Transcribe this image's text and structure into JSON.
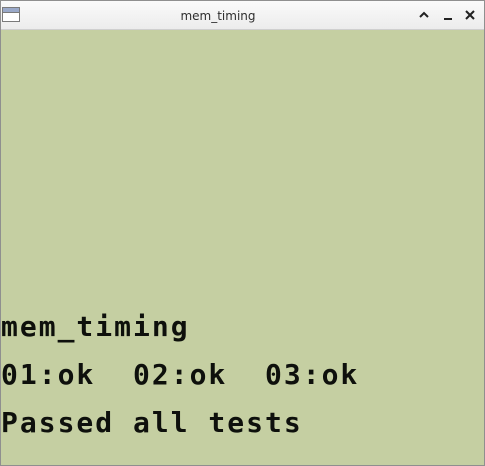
{
  "window": {
    "title": "mem_timing",
    "controls": {
      "maximize": "chevron-up-icon",
      "minimize": "minimize-icon",
      "close": "close-icon"
    }
  },
  "screen": {
    "background": "#c5cfa2",
    "text_color": "#0e100c",
    "lines": [
      "mem_timing",
      "01:ok  02:ok  03:ok",
      "Passed all tests"
    ]
  }
}
